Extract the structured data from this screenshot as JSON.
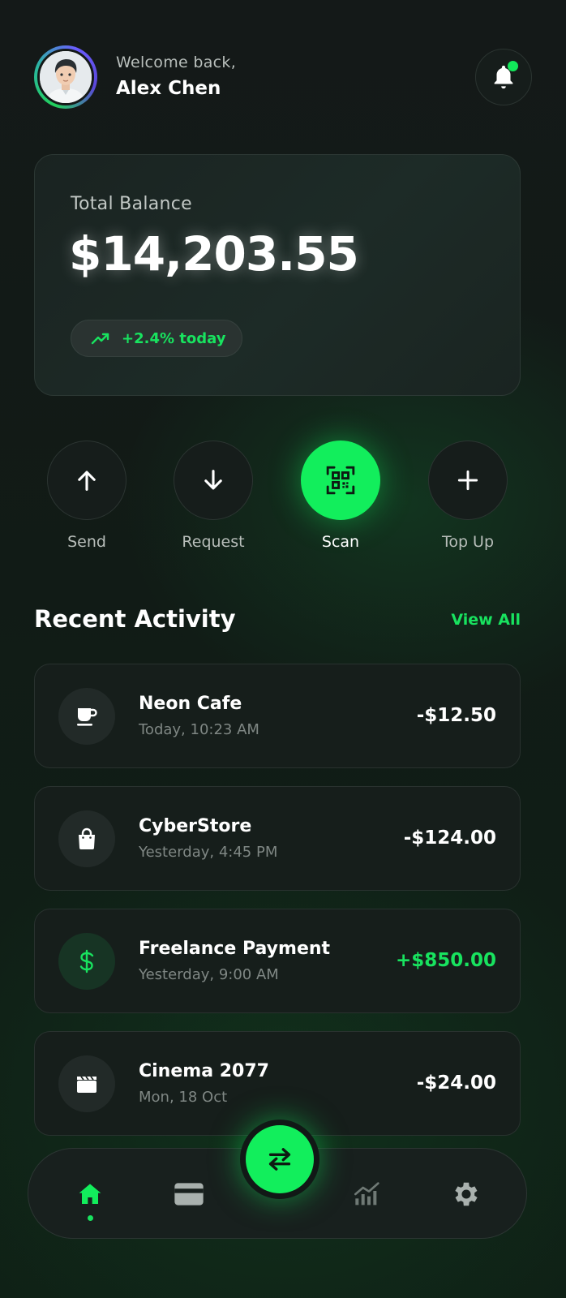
{
  "header": {
    "welcome_text": "Welcome back,",
    "user_name": "Alex Chen",
    "avatar_icon": "user-avatar",
    "notification_icon": "bell-icon"
  },
  "balance": {
    "label": "Total Balance",
    "amount": "$14,203.55",
    "change_text": "+2.4% today"
  },
  "actions": [
    {
      "label": "Send",
      "icon": "arrow-up-icon"
    },
    {
      "label": "Request",
      "icon": "arrow-down-icon"
    },
    {
      "label": "Scan",
      "icon": "qr-scan-icon"
    },
    {
      "label": "Top Up",
      "icon": "plus-icon"
    }
  ],
  "activity": {
    "title": "Recent Activity",
    "view_all_label": "View All",
    "transactions": [
      {
        "name": "Neon Cafe",
        "time": "Today, 10:23 AM",
        "amount": "-$12.50",
        "icon": "coffee-icon"
      },
      {
        "name": "CyberStore",
        "time": "Yesterday, 4:45 PM",
        "amount": "-$124.00",
        "icon": "shopping-bag-icon"
      },
      {
        "name": "Freelance Payment",
        "time": "Yesterday, 9:00 AM",
        "amount": "+$850.00",
        "icon": "dollar-icon"
      },
      {
        "name": "Cinema 2077",
        "time": "Mon, 18 Oct",
        "amount": "-$24.00",
        "icon": "clapperboard-icon"
      }
    ]
  },
  "nav": {
    "items": [
      "home-icon",
      "card-icon",
      "transfer-icon",
      "chart-icon",
      "settings-icon"
    ],
    "active": "home-icon"
  },
  "colors": {
    "accent": "#12ee5c",
    "background": "#0f1614",
    "card": "#161e1b",
    "positive": "#18e35f"
  }
}
